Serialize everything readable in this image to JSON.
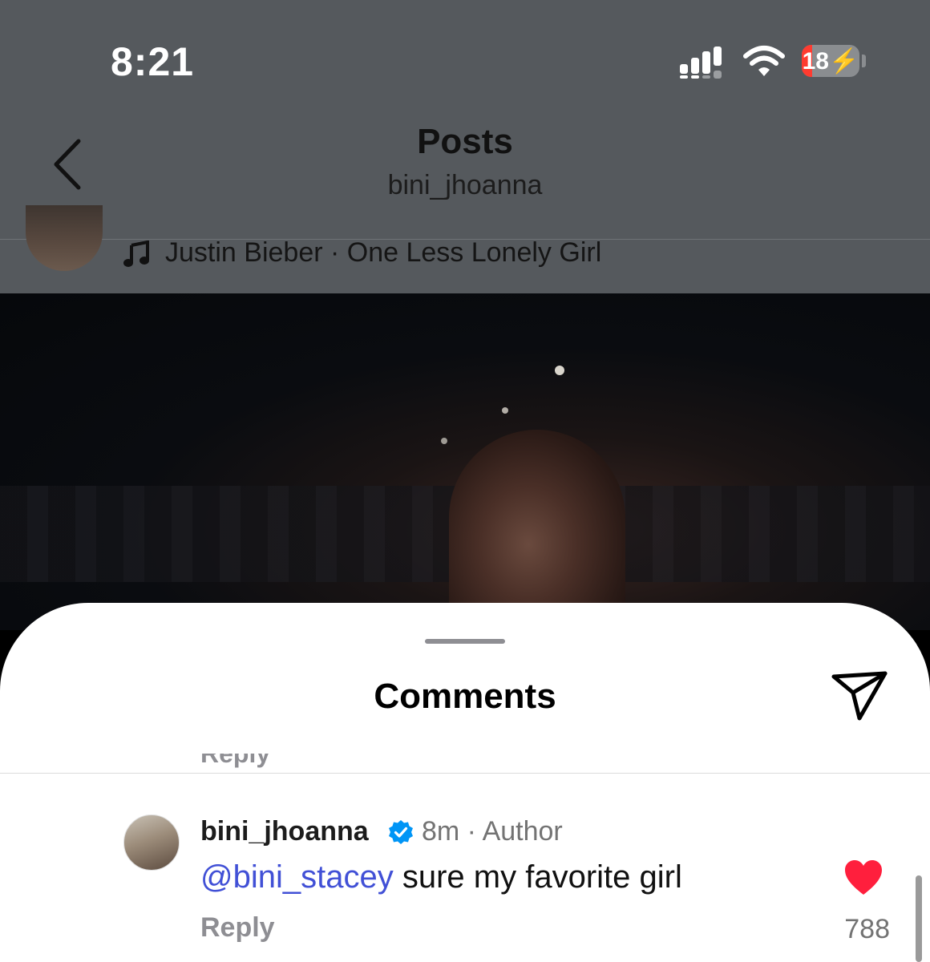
{
  "status_bar": {
    "time": "8:21",
    "battery": "18",
    "battery_level": 0.18
  },
  "header": {
    "title": "Posts",
    "subtitle": "bini_jhoanna"
  },
  "post": {
    "music": "Justin Bieber · One Less Lonely Girl"
  },
  "comments_sheet": {
    "title": "Comments",
    "previous_reply_label": "Reply",
    "comment": {
      "username": "bini_jhoanna",
      "time": "8m",
      "badge": "Author",
      "mention": "@bini_stacey",
      "text": " sure my favorite girl",
      "reply_label": "Reply",
      "likes": "788"
    }
  },
  "colors": {
    "mention": "#4150d6",
    "heart": "#ff1f3d",
    "verified": "#0095f6"
  }
}
